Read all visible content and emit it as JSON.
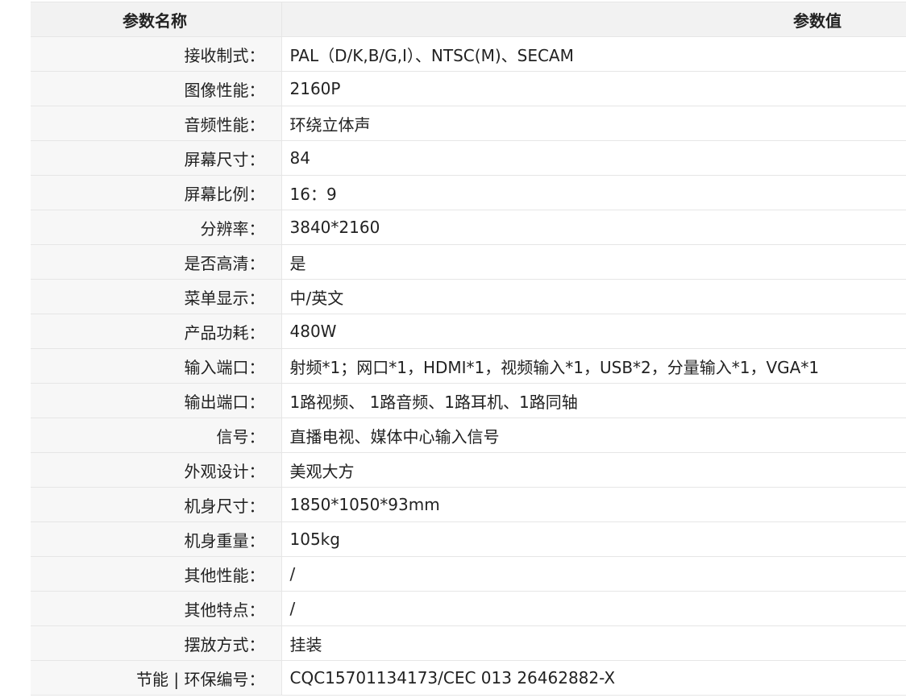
{
  "table": {
    "header": {
      "name": "参数名称",
      "value": "参数值"
    },
    "rows": [
      {
        "name": "接收制式：",
        "value": "PAL（D/K,B/G,I）、NTSC(M)、SECAM"
      },
      {
        "name": "图像性能：",
        "value": "2160P"
      },
      {
        "name": "音频性能：",
        "value": "环绕立体声"
      },
      {
        "name": "屏幕尺寸：",
        "value": "84"
      },
      {
        "name": "屏幕比例：",
        "value": "16：9"
      },
      {
        "name": "分辨率：",
        "value": "3840*2160"
      },
      {
        "name": "是否高清：",
        "value": "是"
      },
      {
        "name": "菜单显示：",
        "value": "中/英文"
      },
      {
        "name": "产品功耗：",
        "value": "480W"
      },
      {
        "name": "输入端口：",
        "value": "射频*1；网口*1，HDMI*1，视频输入*1，USB*2，分量输入*1，VGA*1"
      },
      {
        "name": "输出端口：",
        "value": "1路视频、 1路音频、1路耳机、1路同轴"
      },
      {
        "name": "信号：",
        "value": "直播电视、媒体中心输入信号"
      },
      {
        "name": "外观设计：",
        "value": "美观大方"
      },
      {
        "name": "机身尺寸：",
        "value": "1850*1050*93mm"
      },
      {
        "name": "机身重量：",
        "value": "105kg"
      },
      {
        "name": "其他性能：",
        "value": "/"
      },
      {
        "name": "其他特点：",
        "value": "/"
      },
      {
        "name": "摆放方式：",
        "value": "挂装"
      },
      {
        "name": "节能 | 环保编号：",
        "value": "CQC15701134173/CEC 013 26462882-X"
      }
    ]
  }
}
